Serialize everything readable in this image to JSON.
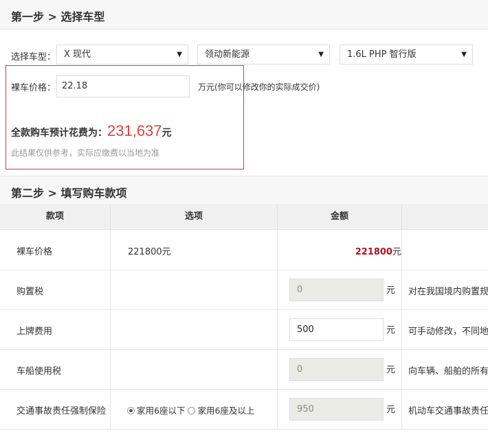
{
  "step1": {
    "title": "第一步 > 选择车型"
  },
  "car_select": {
    "label": "选择车型：",
    "brand": "X 现代",
    "model": "领动新能源",
    "trim": "1.6L PHP 智行版"
  },
  "price": {
    "label": "裸车价格：",
    "value": "22.18",
    "unit_hint": "万元(你可以修改你的实际成交价)"
  },
  "total": {
    "label": "全款购车预计花费为：",
    "amount": "231,637",
    "unit": "元",
    "note": "此结果仅供参考，实际应缴费以当地为准"
  },
  "step2": {
    "title": "第二步 > 填写购车款项"
  },
  "table": {
    "headers": {
      "item": "款项",
      "option": "选项",
      "amount": "金额"
    },
    "rows": [
      {
        "name": "裸车价格",
        "option": "221800元",
        "amount": "221800",
        "amount_unit": "元"
      },
      {
        "name": "购置税",
        "fee": "0",
        "unit": "元",
        "desc": "对在我国境内购置规定车辆"
      },
      {
        "name": "上牌费用",
        "fee": "500",
        "unit": "元",
        "desc": "可手动修改，不同地区"
      },
      {
        "name": "车船使用税",
        "fee": "0",
        "unit": "元",
        "desc": "向车辆、船舶的所有人"
      },
      {
        "name": "交通事故责任强制保险",
        "radio1": "家用6座以下",
        "radio2": "家用6座及以上",
        "fee": "950",
        "unit": "元",
        "desc": "机动车交通事故责任强制"
      }
    ]
  },
  "colors": {
    "accent_red": "#e63e3e",
    "dark_red": "#b5121b",
    "box_border": "#d9363e"
  },
  "icons": {
    "dropdown": "triangle-down-icon",
    "radio": "radio-icon"
  }
}
